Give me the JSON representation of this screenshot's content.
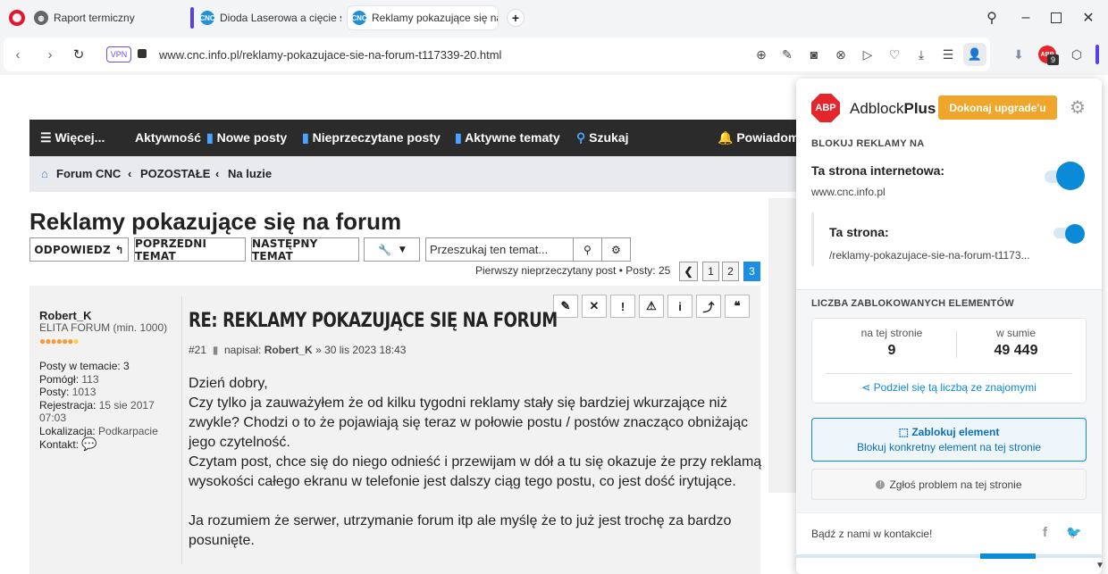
{
  "browser": {
    "tabs": [
      {
        "title": "Raport termiczny",
        "icon": "globe-icon"
      },
      {
        "title": "Dioda Laserowa a cięcie st",
        "icon": "cnc-logo"
      },
      {
        "title": "Reklamy pokazujące się na",
        "icon": "cnc-logo"
      }
    ],
    "vpn_label": "VPN",
    "url": "www.cnc.info.pl/reklamy-pokazujace-sie-na-forum-t117339-20.html",
    "extension_badge": "9"
  },
  "forum": {
    "nav": {
      "more": "Więcej...",
      "activity": "Aktywność",
      "new_posts": "Nowe posty",
      "unread_posts": "Nieprzeczytane posty",
      "active_topics": "Aktywne tematy",
      "search": "Szukaj",
      "notifications": "Powiadom"
    },
    "breadcrumb": [
      "Forum CNC",
      "POZOSTAŁE",
      "Na luzie"
    ],
    "topic_title": "Reklamy pokazujące się na forum",
    "actions": {
      "reply": "ODPOWIEDZ",
      "prev": "POPRZEDNI TEMAT",
      "next": "NASTĘPNY TEMAT",
      "search_placeholder": "Przeszukaj ten temat..."
    },
    "pagination": {
      "info": "Pierwszy nieprzeczytany post • Posty: 25",
      "pages": [
        "1",
        "2",
        "3"
      ],
      "current": "3"
    },
    "post": {
      "author": "Robert_K",
      "rank": "ELITA FORUM (min. 1000)",
      "stats": {
        "topic_posts_label": "Posty w temacie:",
        "topic_posts": "3",
        "helped_label": "Pomógł:",
        "helped": "113",
        "posts_label": "Posty:",
        "posts": "1013",
        "reg_label": "Rejestracja:",
        "reg": "15 sie 2017",
        "reg_time": "07:03",
        "loc_label": "Lokalizacja:",
        "loc": "Podkarpacie",
        "contact_label": "Kontakt:"
      },
      "title": "RE: REKLAMY POKAZUJĄCE SIĘ NA FORUM",
      "number": "#21",
      "meta_prefix": "napisał:",
      "meta_author": "Robert_K",
      "meta_date": "» 30 lis 2023 18:43",
      "lines": [
        "Dzień dobry,",
        "Czy tylko ja zauważyłem że od kilku tygodni reklamy stały się bardziej wkurzające niż",
        "zwykle? Chodzi o to że pojawiają się teraz w połowie postu / postów znacząco obniżając",
        "jego czytelność.",
        "Czytam post, chce się do niego odnieść i przewijam w dół a tu się okazuje że przy reklamą",
        "wysokości całego ekranu w telefonie jest dalszy ciąg tego postu, co jest dość irytujące.",
        "",
        "Ja rozumiem że serwer, utrzymanie forum itp ale myślę że to już jest trochę za bardzo",
        "posunięte."
      ]
    }
  },
  "adblock": {
    "logo": "ABP",
    "brand": "Adblock",
    "brand_bold": "Plus",
    "upgrade": "Dokonaj upgrade'u",
    "block_heading": "BLOKUJ REKLAMY NA",
    "site_label": "Ta strona internetowa:",
    "site_value": "www.cnc.info.pl",
    "page_label": "Ta strona:",
    "page_value": "/reklamy-pokazujace-sie-na-forum-t1173...",
    "count_heading": "LICZBA ZABLOKOWANYCH ELEMENTÓW",
    "on_page_label": "na tej stronie",
    "on_page_value": "9",
    "total_label": "w sumie",
    "total_value": "49 449",
    "share": "Podziel się tą liczbą ze znajomymi",
    "block_element": "Zablokuj element",
    "block_element_sub": "Blokuj konkretny element na tej stronie",
    "report": "Zgłoś problem na tej stronie",
    "contact": "Bądź z nami w kontakcie!"
  },
  "colors": {
    "accent": "#0b8ad8",
    "abp_red": "#e4262c",
    "upgrade_orange": "#f0a62a",
    "nav_dark": "#2b2b2b",
    "current_page": "#1d8fe0"
  }
}
